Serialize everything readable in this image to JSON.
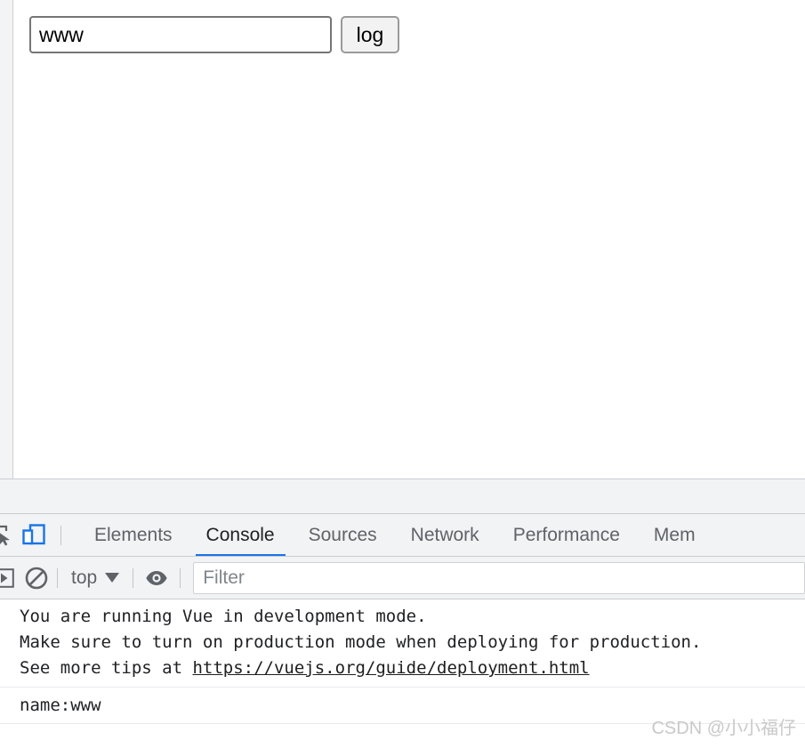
{
  "page": {
    "input": {
      "value": "www",
      "placeholder": ""
    },
    "log_button_label": "log"
  },
  "devtools": {
    "toolbar_icons": {
      "inspect": "inspect-element-icon",
      "device": "device-toolbar-icon"
    },
    "tabs": [
      {
        "label": "Elements",
        "active": false
      },
      {
        "label": "Console",
        "active": true
      },
      {
        "label": "Sources",
        "active": false
      },
      {
        "label": "Network",
        "active": false
      },
      {
        "label": "Performance",
        "active": false
      },
      {
        "label": "Mem",
        "active": false
      }
    ],
    "active_tab_accent": "#1a73e8",
    "console_toolbar": {
      "sidebar_toggle_icon": "show-console-sidebar-icon",
      "clear_icon": "clear-console-icon",
      "context_label": "top",
      "context_caret": "chevron-down-icon",
      "eye_icon": "live-expression-eye-icon",
      "filter_placeholder": "Filter",
      "filter_value": ""
    },
    "console_messages": [
      {
        "type": "info",
        "lines": [
          "You are running Vue in development mode.",
          "Make sure to turn on production mode when deploying for production.",
          "See more tips at "
        ],
        "link": "https://vuejs.org/guide/deployment.html"
      },
      {
        "type": "log",
        "text": "name:www"
      }
    ]
  },
  "watermark": {
    "text": "CSDN @小小福仔"
  }
}
